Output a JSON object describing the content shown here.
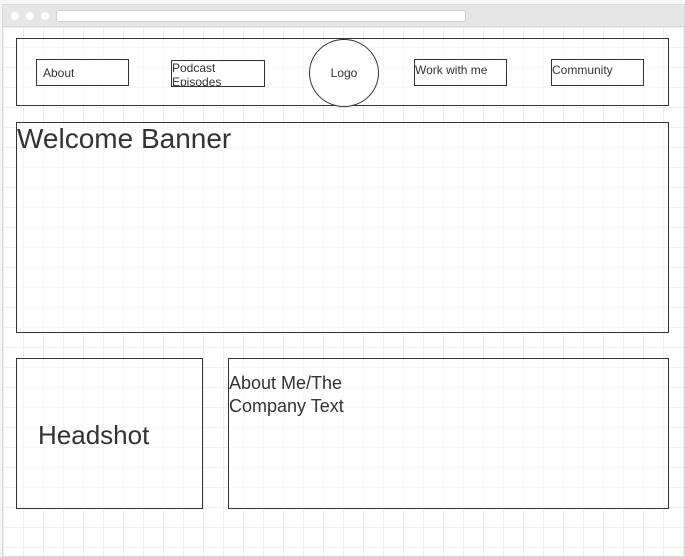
{
  "nav": {
    "about_label": "About",
    "podcast_label": "Podcast Episodes",
    "logo_label": "Logo",
    "work_label": "Work with me",
    "community_label": "Community"
  },
  "banner": {
    "title": "Welcome Banner"
  },
  "headshot": {
    "label": "Headshot"
  },
  "about": {
    "label": "About Me/The Company Text"
  }
}
